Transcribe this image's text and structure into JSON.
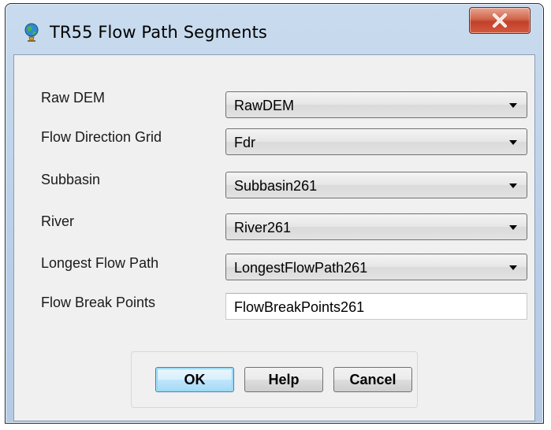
{
  "window": {
    "title": "TR55 Flow Path Segments",
    "close_symbol": "X"
  },
  "fields": [
    {
      "label": "Raw DEM",
      "value": "RawDEM",
      "type": "combo"
    },
    {
      "label": "Flow Direction Grid",
      "value": "Fdr",
      "type": "combo"
    },
    {
      "label": "Subbasin",
      "value": "Subbasin261",
      "type": "combo"
    },
    {
      "label": "River",
      "value": "River261",
      "type": "combo"
    },
    {
      "label": "Longest Flow Path",
      "value": "LongestFlowPath261",
      "type": "combo"
    },
    {
      "label": "Flow Break Points",
      "value": "FlowBreakPoints261",
      "type": "text"
    }
  ],
  "buttons": {
    "ok": "OK",
    "help": "Help",
    "cancel": "Cancel"
  },
  "colors": {
    "titlebar": "#b9cfe8",
    "client": "#f0f0f0",
    "close_button": "#c2402a",
    "default_button_border": "#3c7fb1"
  },
  "icons": {
    "title": "globe-icon",
    "close": "close-icon",
    "dropdown": "chevron-down-icon"
  }
}
